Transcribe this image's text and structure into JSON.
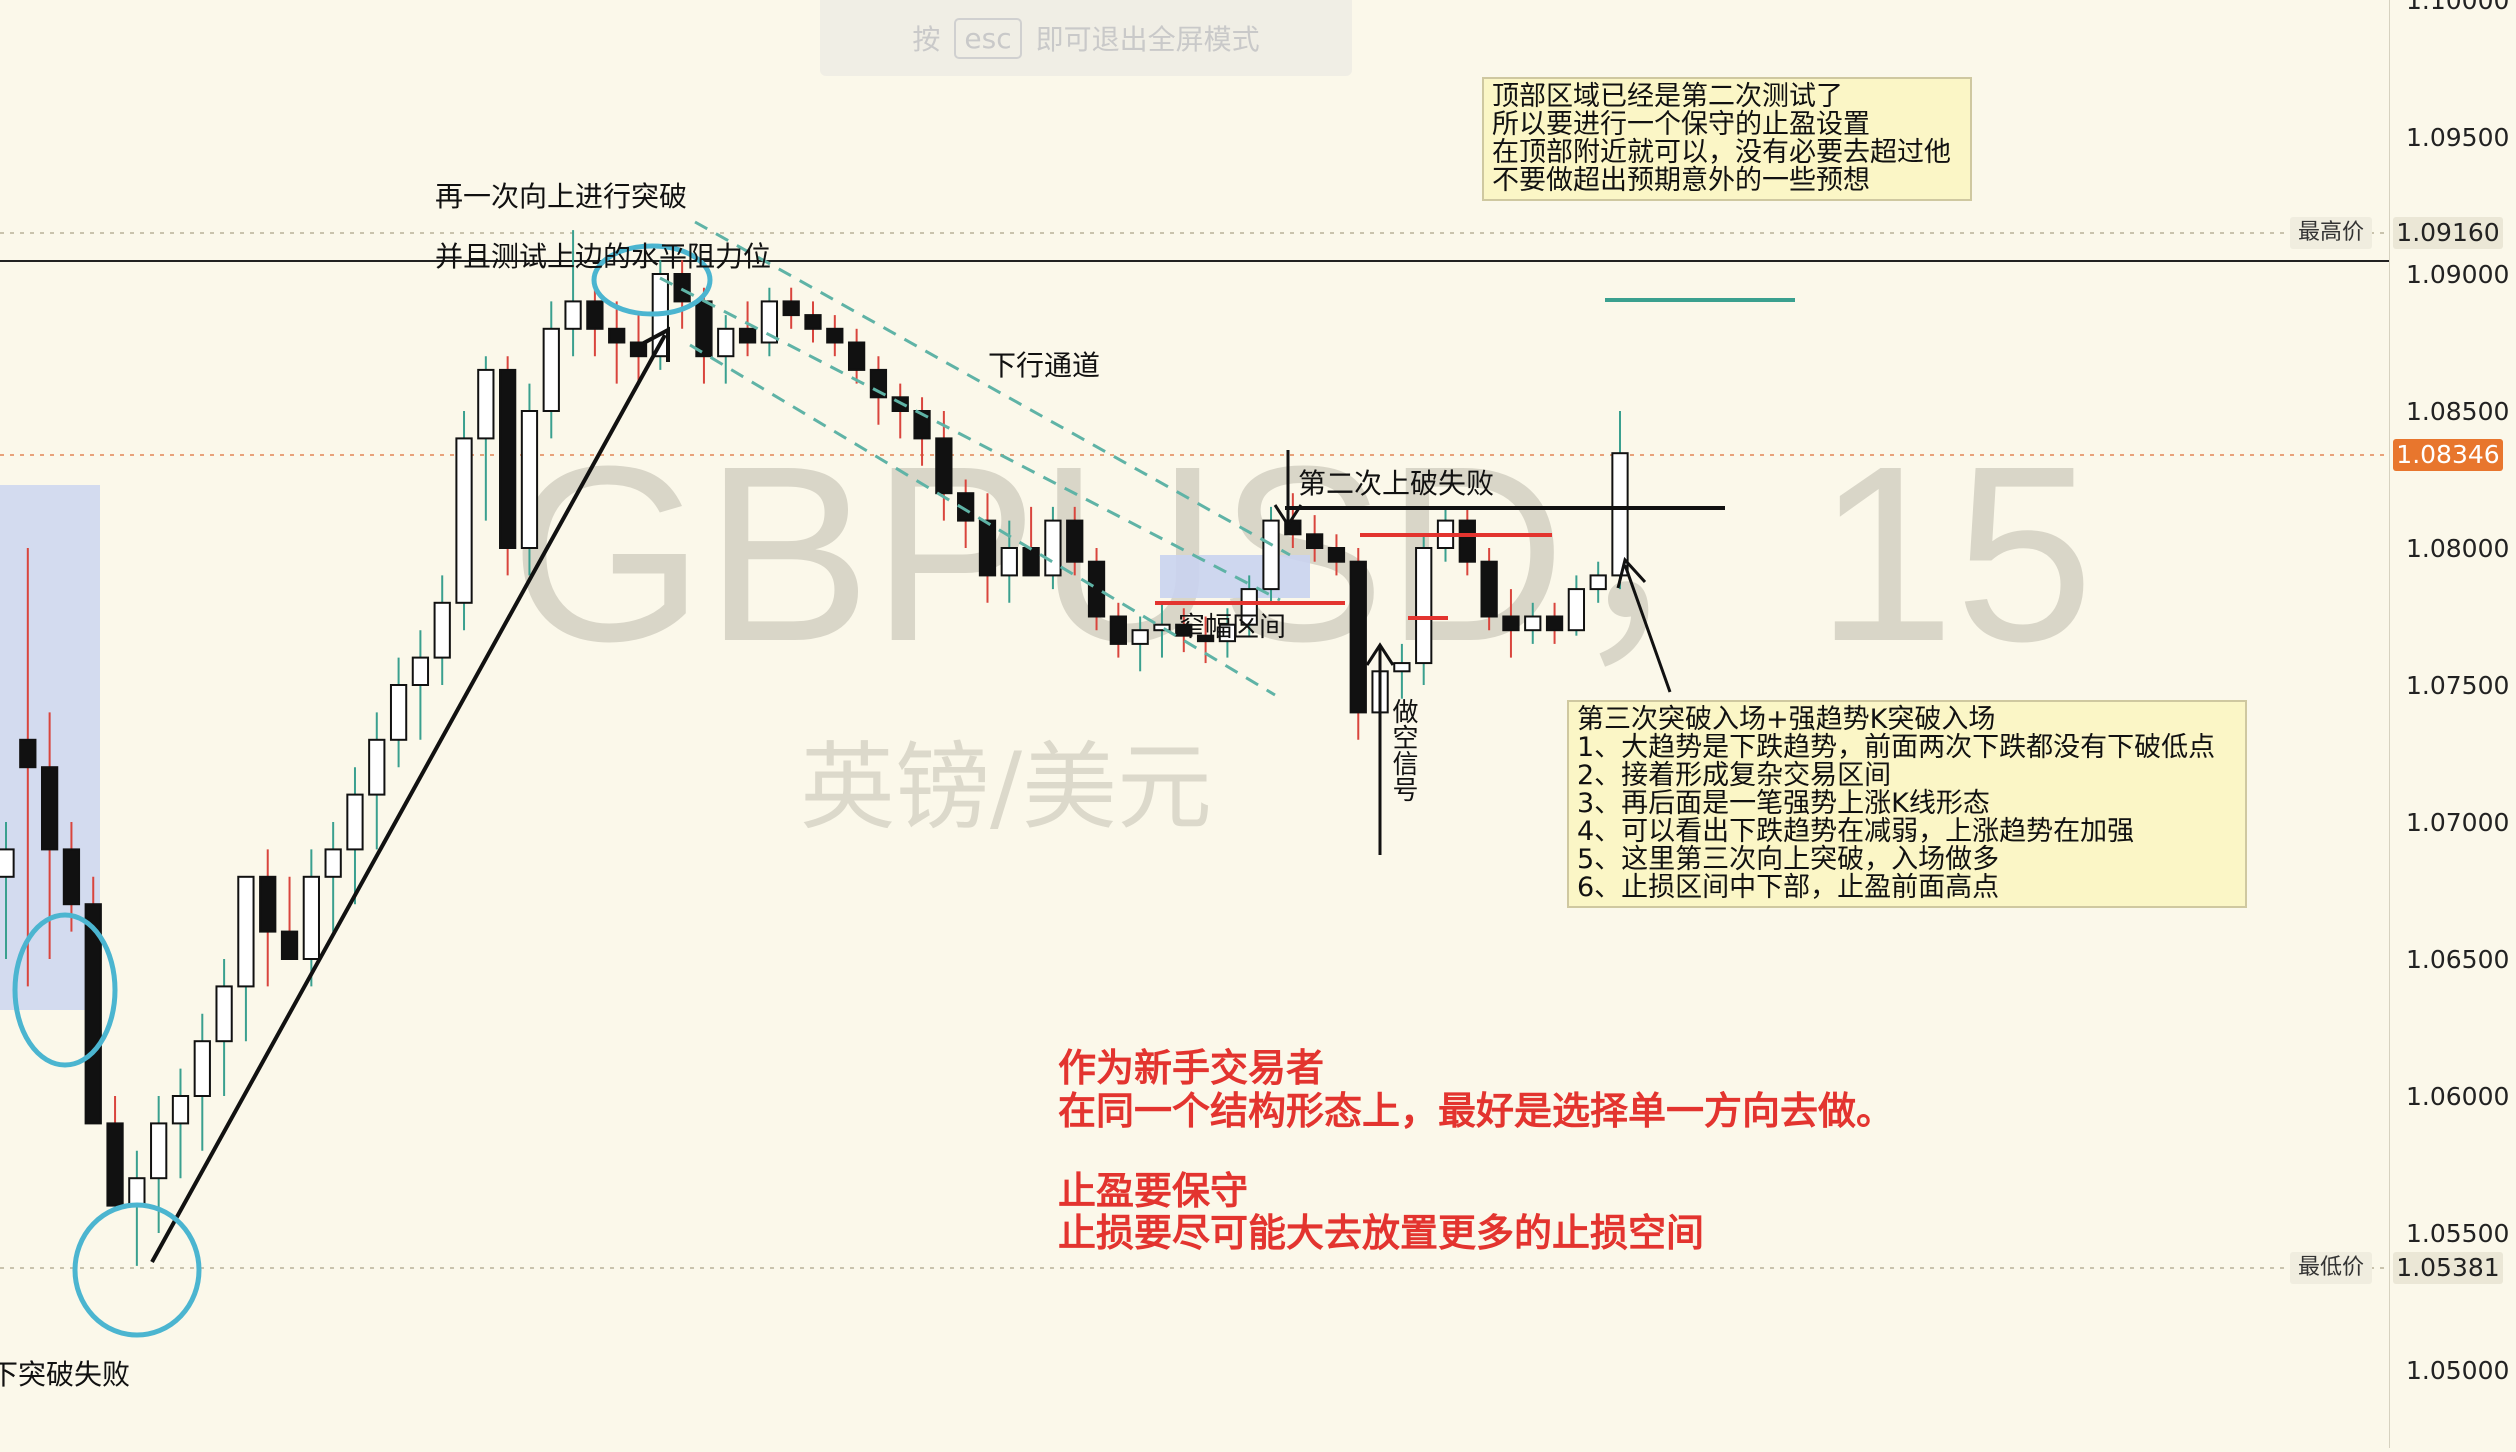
{
  "fullscreen_hint": {
    "prefix": "按",
    "key": "esc",
    "suffix": "即可退出全屏模式"
  },
  "watermark": {
    "symbol": "GBPUSD，15",
    "name": "英镑/美元"
  },
  "annotations": {
    "breakout_label": [
      "再一次向上进行突破",
      "并且测试上边的水平阻力位"
    ],
    "channel_label": "下行通道",
    "second_break_fail": "第二次上破失败",
    "narrow_range": "窄幅区间",
    "short_signal": "做空信号",
    "left_fail": "下突破失败"
  },
  "top_note": [
    "顶部区域已经是第二次测试了",
    "所以要进行一个保守的止盈设置",
    "在顶部附近就可以，没有必要去超过他",
    "不要做超出预期意外的一些预想"
  ],
  "entry_note": [
    "第三次突破入场+强趋势K突破入场",
    "1、大趋势是下跌趋势，前面两次下跌都没有下破低点",
    "2、接着形成复杂交易区间",
    "3、再后面是一笔强势上涨K线形态",
    "4、可以看出下跌趋势在减弱，上涨趋势在加强",
    "5、这里第三次向上突破，入场做多",
    "6、止损区间中下部，止盈前面高点"
  ],
  "advice": [
    "作为新手交易者",
    "在同一个结构形态上，最好是选择单一方向去做。",
    "",
    "止盈要保守",
    "止损要尽可能大去放置更多的止损空间"
  ],
  "price_axis": {
    "ticks": [
      "1.10000",
      "1.09500",
      "1.09000",
      "1.08500",
      "1.08000",
      "1.07500",
      "1.07000",
      "1.06500",
      "1.06000",
      "1.05500",
      "1.05000"
    ],
    "high": {
      "label": "最高价",
      "value": "1.09160"
    },
    "current": {
      "value": "1.08346",
      "color": "#e8762d"
    },
    "low": {
      "label": "最低价",
      "value": "1.05381"
    }
  },
  "colors": {
    "background": "#fbf8ea",
    "accent_red": "#e3342f",
    "circle_blue": "#4bb5d0",
    "channel_green": "#5fb3a6",
    "zone_blue": "#c9d3f0"
  },
  "chart_data": {
    "type": "candlestick",
    "symbol": "GBPUSD",
    "timeframe": "15",
    "ylim": [
      1.05,
      1.1
    ],
    "high": 1.0916,
    "low": 1.05381,
    "last": 1.08346,
    "candles": [
      {
        "o": 1.068,
        "h": 1.07,
        "l": 1.065,
        "c": 1.069
      },
      {
        "o": 1.073,
        "h": 1.08,
        "l": 1.064,
        "c": 1.072
      },
      {
        "o": 1.072,
        "h": 1.074,
        "l": 1.065,
        "c": 1.069
      },
      {
        "o": 1.069,
        "h": 1.07,
        "l": 1.066,
        "c": 1.067
      },
      {
        "o": 1.067,
        "h": 1.068,
        "l": 1.063,
        "c": 1.059
      },
      {
        "o": 1.059,
        "h": 1.06,
        "l": 1.056,
        "c": 1.056
      },
      {
        "o": 1.056,
        "h": 1.058,
        "l": 1.0538,
        "c": 1.057
      },
      {
        "o": 1.057,
        "h": 1.06,
        "l": 1.055,
        "c": 1.059
      },
      {
        "o": 1.059,
        "h": 1.061,
        "l": 1.057,
        "c": 1.06
      },
      {
        "o": 1.06,
        "h": 1.063,
        "l": 1.058,
        "c": 1.062
      },
      {
        "o": 1.062,
        "h": 1.065,
        "l": 1.06,
        "c": 1.064
      },
      {
        "o": 1.064,
        "h": 1.068,
        "l": 1.062,
        "c": 1.068
      },
      {
        "o": 1.068,
        "h": 1.069,
        "l": 1.064,
        "c": 1.066
      },
      {
        "o": 1.066,
        "h": 1.068,
        "l": 1.065,
        "c": 1.065
      },
      {
        "o": 1.065,
        "h": 1.069,
        "l": 1.064,
        "c": 1.068
      },
      {
        "o": 1.068,
        "h": 1.07,
        "l": 1.066,
        "c": 1.069
      },
      {
        "o": 1.069,
        "h": 1.072,
        "l": 1.067,
        "c": 1.071
      },
      {
        "o": 1.071,
        "h": 1.074,
        "l": 1.069,
        "c": 1.073
      },
      {
        "o": 1.073,
        "h": 1.076,
        "l": 1.072,
        "c": 1.075
      },
      {
        "o": 1.075,
        "h": 1.077,
        "l": 1.073,
        "c": 1.076
      },
      {
        "o": 1.076,
        "h": 1.079,
        "l": 1.075,
        "c": 1.078
      },
      {
        "o": 1.078,
        "h": 1.085,
        "l": 1.077,
        "c": 1.084
      },
      {
        "o": 1.084,
        "h": 1.087,
        "l": 1.081,
        "c": 1.0865
      },
      {
        "o": 1.0865,
        "h": 1.087,
        "l": 1.079,
        "c": 1.08
      },
      {
        "o": 1.08,
        "h": 1.086,
        "l": 1.079,
        "c": 1.085
      },
      {
        "o": 1.085,
        "h": 1.089,
        "l": 1.084,
        "c": 1.088
      },
      {
        "o": 1.088,
        "h": 1.0916,
        "l": 1.087,
        "c": 1.089
      },
      {
        "o": 1.089,
        "h": 1.09,
        "l": 1.087,
        "c": 1.088
      },
      {
        "o": 1.088,
        "h": 1.089,
        "l": 1.086,
        "c": 1.0875
      },
      {
        "o": 1.0875,
        "h": 1.0885,
        "l": 1.086,
        "c": 1.087
      },
      {
        "o": 1.087,
        "h": 1.0905,
        "l": 1.0865,
        "c": 1.09
      },
      {
        "o": 1.09,
        "h": 1.0905,
        "l": 1.088,
        "c": 1.089
      },
      {
        "o": 1.089,
        "h": 1.0895,
        "l": 1.086,
        "c": 1.087
      },
      {
        "o": 1.087,
        "h": 1.0885,
        "l": 1.086,
        "c": 1.088
      },
      {
        "o": 1.088,
        "h": 1.089,
        "l": 1.087,
        "c": 1.0875
      },
      {
        "o": 1.0875,
        "h": 1.0895,
        "l": 1.087,
        "c": 1.089
      },
      {
        "o": 1.089,
        "h": 1.0895,
        "l": 1.088,
        "c": 1.0885
      },
      {
        "o": 1.0885,
        "h": 1.089,
        "l": 1.0875,
        "c": 1.088
      },
      {
        "o": 1.088,
        "h": 1.0885,
        "l": 1.087,
        "c": 1.0875
      },
      {
        "o": 1.0875,
        "h": 1.088,
        "l": 1.086,
        "c": 1.0865
      },
      {
        "o": 1.0865,
        "h": 1.087,
        "l": 1.0845,
        "c": 1.0855
      },
      {
        "o": 1.0855,
        "h": 1.086,
        "l": 1.084,
        "c": 1.085
      },
      {
        "o": 1.085,
        "h": 1.0855,
        "l": 1.083,
        "c": 1.084
      },
      {
        "o": 1.084,
        "h": 1.085,
        "l": 1.081,
        "c": 1.082
      },
      {
        "o": 1.082,
        "h": 1.0825,
        "l": 1.08,
        "c": 1.081
      },
      {
        "o": 1.081,
        "h": 1.082,
        "l": 1.078,
        "c": 1.079
      },
      {
        "o": 1.079,
        "h": 1.081,
        "l": 1.078,
        "c": 1.08
      },
      {
        "o": 1.08,
        "h": 1.0815,
        "l": 1.079,
        "c": 1.079
      },
      {
        "o": 1.079,
        "h": 1.0815,
        "l": 1.0785,
        "c": 1.081
      },
      {
        "o": 1.081,
        "h": 1.0815,
        "l": 1.079,
        "c": 1.0795
      },
      {
        "o": 1.0795,
        "h": 1.08,
        "l": 1.077,
        "c": 1.0775
      },
      {
        "o": 1.0775,
        "h": 1.078,
        "l": 1.076,
        "c": 1.0765
      },
      {
        "o": 1.0765,
        "h": 1.0775,
        "l": 1.0755,
        "c": 1.077
      },
      {
        "o": 1.077,
        "h": 1.078,
        "l": 1.076,
        "c": 1.0772
      },
      {
        "o": 1.0772,
        "h": 1.0778,
        "l": 1.0762,
        "c": 1.0768
      },
      {
        "o": 1.0768,
        "h": 1.0775,
        "l": 1.0758,
        "c": 1.0766
      },
      {
        "o": 1.0766,
        "h": 1.0778,
        "l": 1.076,
        "c": 1.0772
      },
      {
        "o": 1.0772,
        "h": 1.079,
        "l": 1.0768,
        "c": 1.0785
      },
      {
        "o": 1.0785,
        "h": 1.0815,
        "l": 1.078,
        "c": 1.081
      },
      {
        "o": 1.081,
        "h": 1.082,
        "l": 1.08,
        "c": 1.0805
      },
      {
        "o": 1.0805,
        "h": 1.0812,
        "l": 1.0795,
        "c": 1.08
      },
      {
        "o": 1.08,
        "h": 1.0805,
        "l": 1.079,
        "c": 1.0795
      },
      {
        "o": 1.0795,
        "h": 1.08,
        "l": 1.073,
        "c": 1.074
      },
      {
        "o": 1.074,
        "h": 1.076,
        "l": 1.073,
        "c": 1.0755
      },
      {
        "o": 1.0755,
        "h": 1.0765,
        "l": 1.0745,
        "c": 1.0758
      },
      {
        "o": 1.0758,
        "h": 1.0805,
        "l": 1.075,
        "c": 1.08
      },
      {
        "o": 1.08,
        "h": 1.0815,
        "l": 1.0795,
        "c": 1.081
      },
      {
        "o": 1.081,
        "h": 1.0815,
        "l": 1.079,
        "c": 1.0795
      },
      {
        "o": 1.0795,
        "h": 1.08,
        "l": 1.077,
        "c": 1.0775
      },
      {
        "o": 1.0775,
        "h": 1.0785,
        "l": 1.076,
        "c": 1.077
      },
      {
        "o": 1.077,
        "h": 1.078,
        "l": 1.0765,
        "c": 1.0775
      },
      {
        "o": 1.0775,
        "h": 1.078,
        "l": 1.0765,
        "c": 1.077
      },
      {
        "o": 1.077,
        "h": 1.079,
        "l": 1.0768,
        "c": 1.0785
      },
      {
        "o": 1.0785,
        "h": 1.0795,
        "l": 1.078,
        "c": 1.079
      },
      {
        "o": 1.079,
        "h": 1.085,
        "l": 1.0785,
        "c": 1.08346
      }
    ]
  }
}
